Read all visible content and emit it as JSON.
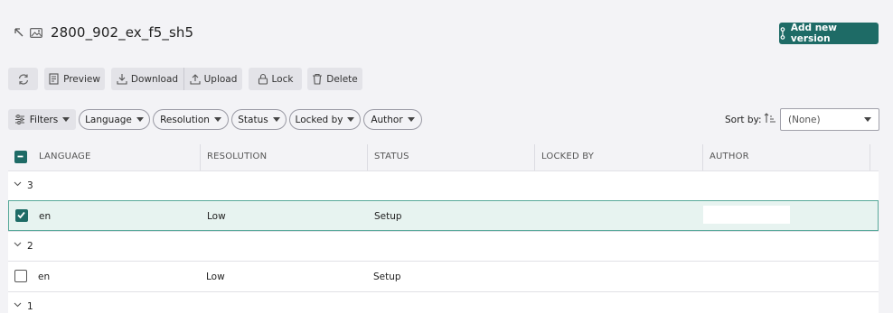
{
  "header": {
    "title": "2800_902_ex_f5_sh5",
    "add_version_label": "Add new version"
  },
  "toolbar": {
    "preview": "Preview",
    "download": "Download",
    "upload": "Upload",
    "lock": "Lock",
    "delete": "Delete"
  },
  "filters": {
    "filters_label": "Filters",
    "pills": [
      "Language",
      "Resolution",
      "Status",
      "Locked by",
      "Author"
    ]
  },
  "sort": {
    "label": "Sort by:",
    "value": "(None)"
  },
  "table": {
    "columns": [
      "LANGUAGE",
      "RESOLUTION",
      "STATUS",
      "LOCKED BY",
      "AUTHOR"
    ],
    "groups": [
      {
        "label": "3",
        "rows": [
          {
            "language": "en",
            "resolution": "Low",
            "status": "Setup",
            "locked_by": "",
            "author": "",
            "selected": true
          }
        ]
      },
      {
        "label": "2",
        "rows": [
          {
            "language": "en",
            "resolution": "Low",
            "status": "Setup",
            "locked_by": "",
            "author": "",
            "selected": false
          }
        ]
      },
      {
        "label": "1",
        "rows": []
      }
    ]
  },
  "colors": {
    "accent": "#1e6b66",
    "selected_row_bg": "#e7f3f0",
    "selected_row_border": "#58a99a"
  }
}
